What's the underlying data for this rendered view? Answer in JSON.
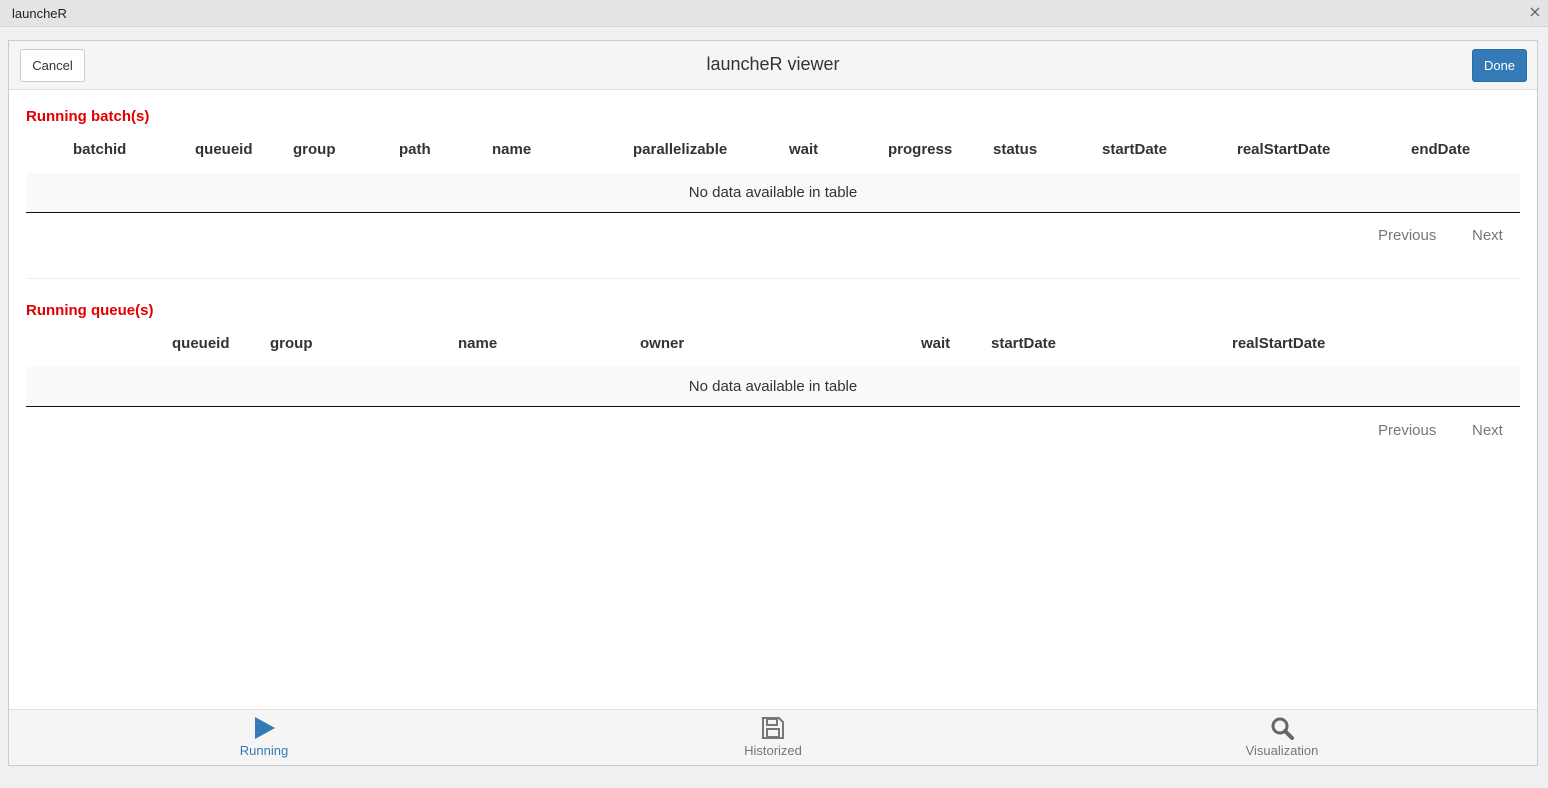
{
  "window": {
    "title": "launcheR",
    "close_glyph": "×"
  },
  "gadget": {
    "title": "launcheR viewer",
    "cancel_label": "Cancel",
    "done_label": "Done",
    "accent_color": "#337ab7"
  },
  "batches": {
    "title": "Running batch(s)",
    "columns": [
      "batchid",
      "queueid",
      "group",
      "path",
      "name",
      "parallelizable",
      "wait",
      "progress",
      "status",
      "startDate",
      "realStartDate",
      "endDate"
    ],
    "empty_message": "No data available in table",
    "previous_label": "Previous",
    "next_label": "Next"
  },
  "queues": {
    "title": "Running queue(s)",
    "columns": [
      "queueid",
      "group",
      "name",
      "owner",
      "wait",
      "startDate",
      "realStartDate"
    ],
    "empty_message": "No data available in table",
    "previous_label": "Previous",
    "next_label": "Next"
  },
  "tabs": [
    {
      "label": "Running",
      "icon": "play-icon",
      "active": true
    },
    {
      "label": "Historized",
      "icon": "floppy-disk-icon",
      "active": false
    },
    {
      "label": "Visualization",
      "icon": "search-icon",
      "active": false
    }
  ],
  "colors": {
    "section_title": "#e00000",
    "active_tab": "#337ab7",
    "inactive_tab": "#777777"
  }
}
